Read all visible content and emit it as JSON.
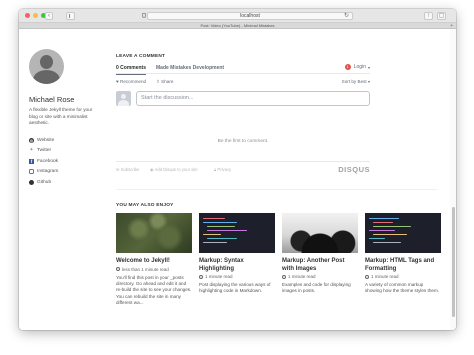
{
  "browser": {
    "address_text": "localhost",
    "tab_title": "Post: Video (YouTube) - Minimal Mistakes",
    "traffic_lights": [
      "#fc605b",
      "#fdbc40",
      "#34c84a"
    ]
  },
  "sidebar": {
    "author_name": "Michael Rose",
    "author_bio": "A flexible Jekyll theme for your blog or site with a minimalist aesthetic.",
    "links": [
      {
        "label": "Website",
        "icon": "globe-icon"
      },
      {
        "label": "Twitter",
        "icon": "twitter-icon"
      },
      {
        "label": "Facebook",
        "icon": "facebook-icon"
      },
      {
        "label": "Instagram",
        "icon": "instagram-icon"
      },
      {
        "label": "Github",
        "icon": "github-icon"
      }
    ]
  },
  "comments": {
    "heading": "LEAVE A COMMENT",
    "tab_comments": "0 Comments",
    "tab_community": "Made Mistakes Development",
    "login_label": "Login",
    "login_badge": "1",
    "recommend_label": "Recommend",
    "share_label": "Share",
    "sort_label": "Sort by Best",
    "discussion_placeholder": "Start the discussion...",
    "empty_text": "Be the first to comment.",
    "footer_subscribe": "Subscribe",
    "footer_add_disqus": "Add Disqus to your site",
    "footer_privacy": "Privacy",
    "disqus_logo": "DISQUS"
  },
  "related": {
    "heading": "YOU MAY ALSO ENJOY",
    "cards": [
      {
        "title": "Welcome to Jekyll!",
        "meta": "less than 1 minute read",
        "excerpt": "You'll find this post in your _posts directory. Go ahead and edit it and re-build the site to see your changes. You can rebuild the site in many different wa..."
      },
      {
        "title": "Markup: Syntax Highlighting",
        "meta": "1 minute read",
        "excerpt": "Post displaying the various ways of highlighting code in Markdown."
      },
      {
        "title": "Markup: Another Post with Images",
        "meta": "1 minute read",
        "excerpt": "Examples and code for displaying images in posts."
      },
      {
        "title": "Markup: HTML Tags and Formatting",
        "meta": "1 minute read",
        "excerpt": "A variety of common markup showing how the theme styles them."
      }
    ]
  }
}
